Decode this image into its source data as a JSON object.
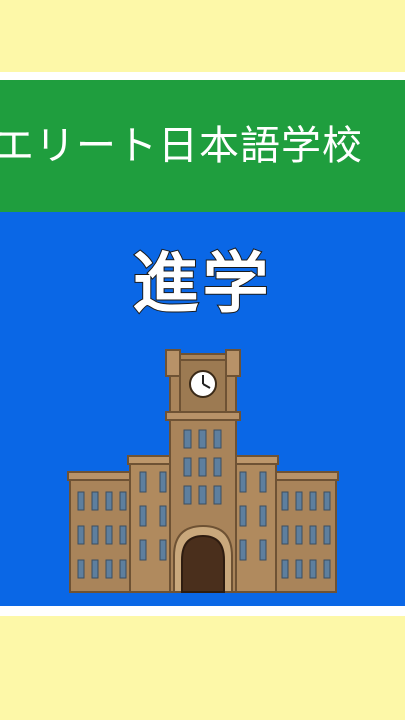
{
  "banner": {
    "title": "エリート日本語学校"
  },
  "main": {
    "heading": "進学",
    "illustration_icon": "university-building-clock-tower-icon"
  },
  "colors": {
    "background": "#fdf8a8",
    "banner": "#1f9e3e",
    "panel": "#0a67e6",
    "building": "#a9845a"
  }
}
